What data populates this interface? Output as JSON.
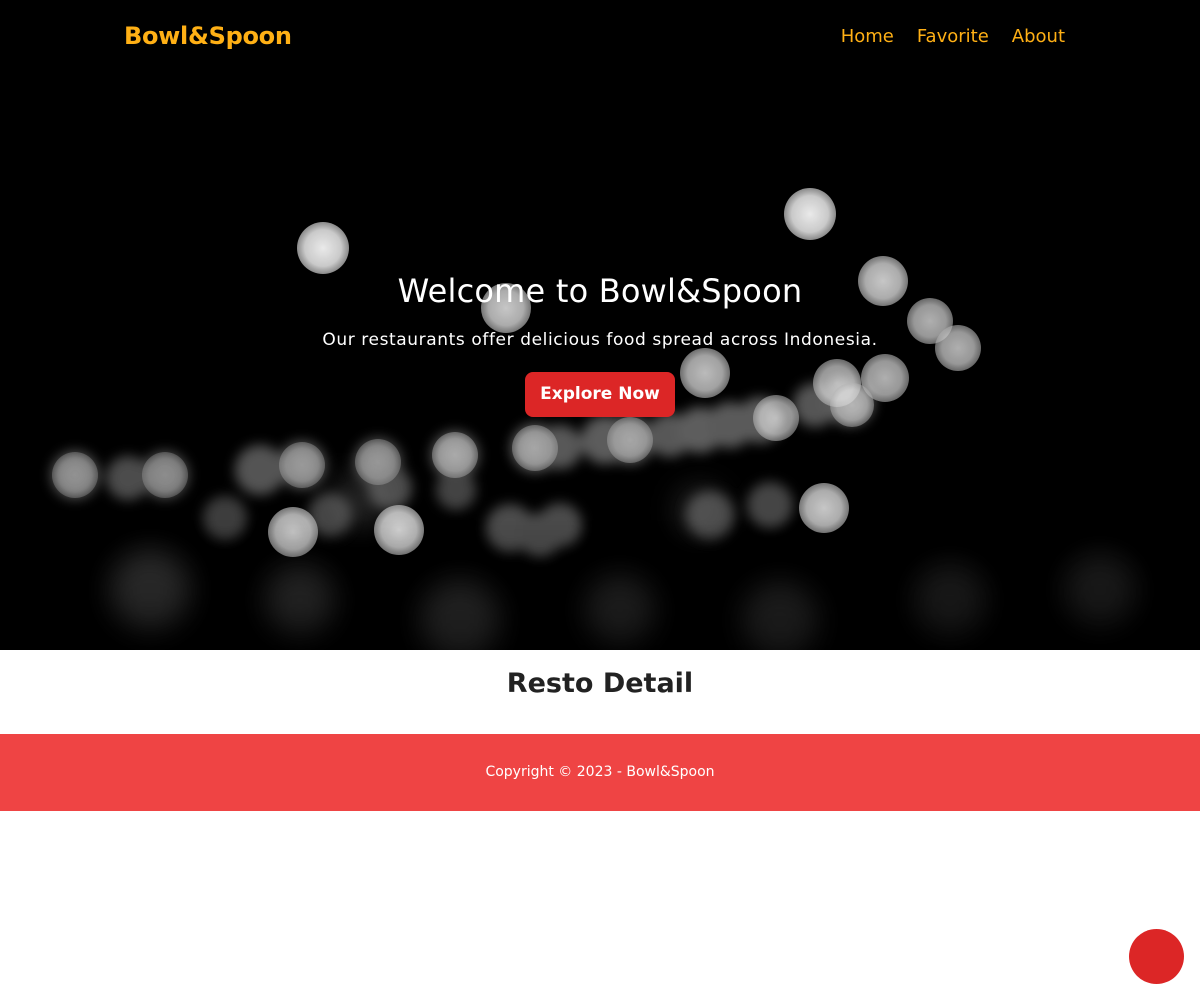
{
  "navbar": {
    "brand": "Bowl&Spoon",
    "links": [
      {
        "label": "Home"
      },
      {
        "label": "Favorite"
      },
      {
        "label": "About"
      }
    ]
  },
  "hero": {
    "title": "Welcome to Bowl&Spoon",
    "tagline": "Our restaurants offer delicious food spread across Indonesia.",
    "cta_label": "Explore Now"
  },
  "main": {
    "section_title": "Resto Detail"
  },
  "footer": {
    "copyright": "Copyright © 2023 - Bowl&Spoon"
  },
  "colors": {
    "brand_accent": "#ffb015",
    "primary_red": "#dc2626",
    "footer_red": "#ef4444",
    "hero_background": "#000000"
  },
  "icons": {
    "floating_button": "chat-bubble-icon"
  }
}
